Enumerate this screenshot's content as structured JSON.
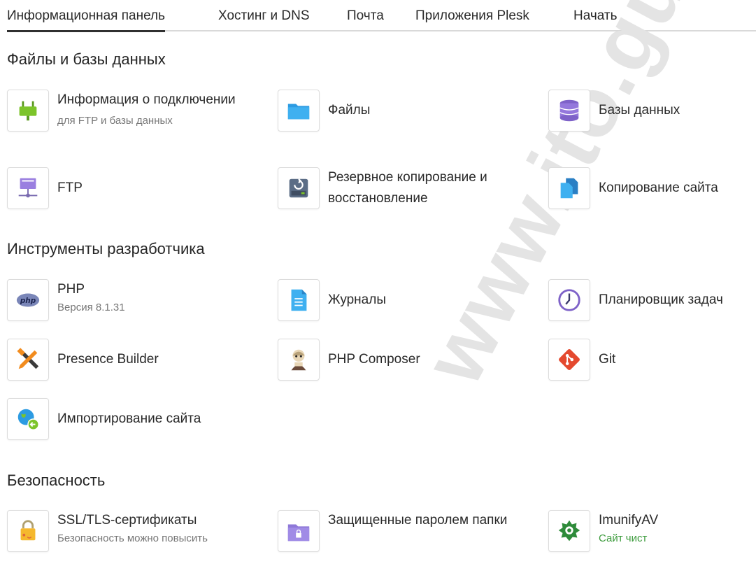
{
  "tabs": [
    {
      "label": "Информационная панель"
    },
    {
      "label": "Хостинг и DNS"
    },
    {
      "label": "Почта"
    },
    {
      "label": "Приложения Plesk"
    },
    {
      "label": "Начать"
    }
  ],
  "watermark": "www.ito.gu",
  "sections": {
    "files": {
      "title": "Файлы и базы данных",
      "items": [
        {
          "label": "Информация о подключении",
          "sub": "для FTP и базы данных",
          "icon": "plug-icon"
        },
        {
          "label": "Файлы",
          "icon": "folder-icon"
        },
        {
          "label": "Базы данных",
          "icon": "database-icon"
        },
        {
          "label": "FTP",
          "icon": "ftp-server-icon"
        },
        {
          "label": "Резервное копирование и восстановление",
          "icon": "backup-drive-icon"
        },
        {
          "label": "Копирование сайта",
          "icon": "copy-site-icon"
        }
      ]
    },
    "dev": {
      "title": "Инструменты разработчика",
      "items": [
        {
          "label": "PHP",
          "sub": "Версия 8.1.31",
          "icon": "php-icon"
        },
        {
          "label": "Журналы",
          "icon": "log-file-icon"
        },
        {
          "label": "Планировщик задач",
          "icon": "clock-icon"
        },
        {
          "label": "Presence Builder",
          "icon": "builder-tools-icon"
        },
        {
          "label": "PHP Composer",
          "icon": "composer-icon"
        },
        {
          "label": "Git",
          "icon": "git-icon"
        },
        {
          "label": "Импортирование сайта",
          "icon": "globe-import-icon"
        }
      ]
    },
    "security": {
      "title": "Безопасность",
      "items": [
        {
          "label": "SSL/TLS-сертификаты",
          "sub": "Безопасность можно повысить",
          "icon": "padlock-icon"
        },
        {
          "label": "Защищенные паролем папки",
          "icon": "locked-folder-icon"
        },
        {
          "label": "ImunifyAV",
          "sub": "Сайт чист",
          "sub_color": "#3c9b3c",
          "icon": "imunify-icon"
        }
      ]
    }
  }
}
